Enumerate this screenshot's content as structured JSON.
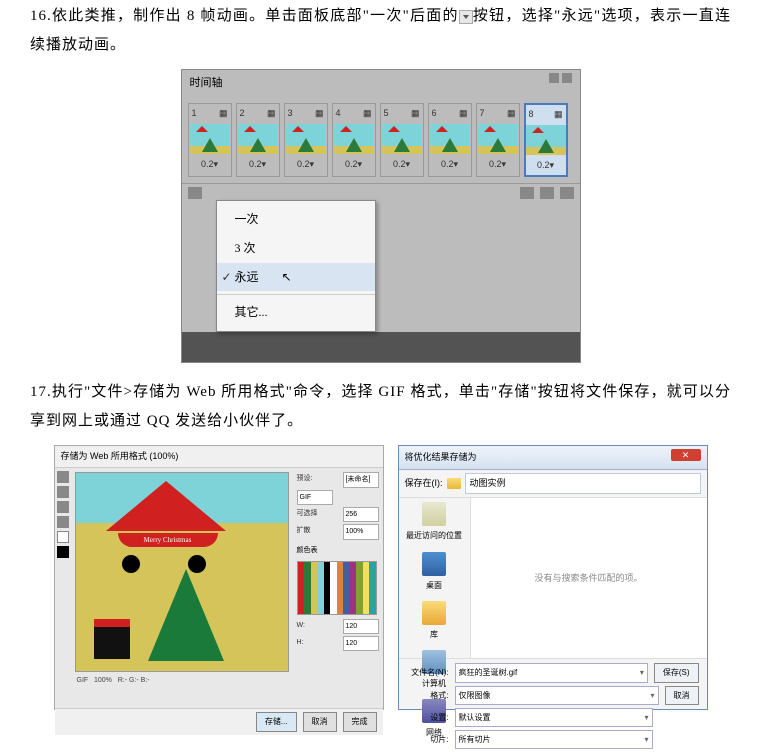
{
  "step16": {
    "text_part1": "16.依此类推，制作出 8 帧动画。单击面板底部\"一次\"后面的",
    "text_part2": "按钮，选择\"永远\"选项，表示一直连续播放动画。"
  },
  "timeline": {
    "title": "时间轴",
    "frames": [
      {
        "num": "1",
        "delay": "0.2▾"
      },
      {
        "num": "2",
        "delay": "0.2▾"
      },
      {
        "num": "3",
        "delay": "0.2▾"
      },
      {
        "num": "4",
        "delay": "0.2▾"
      },
      {
        "num": "5",
        "delay": "0.2▾"
      },
      {
        "num": "6",
        "delay": "0.2▾"
      },
      {
        "num": "7",
        "delay": "0.2▾"
      },
      {
        "num": "8",
        "delay": "0.2▾"
      }
    ],
    "loop_menu": {
      "once": "一次",
      "three": "3 次",
      "forever": "永远",
      "other": "其它..."
    }
  },
  "step17": {
    "text": "17.执行\"文件>存储为 Web 所用格式\"命令，选择 GIF 格式，单击\"存储\"按钮将文件保存，就可以分享到网上或通过 QQ 发送给小伙伴了。"
  },
  "sfw": {
    "title": "存储为 Web 所用格式 (100%)",
    "banner": "Merry Christmas",
    "preset_label": "预设:",
    "preset_value": "[未命名]",
    "format": "GIF",
    "table_label": "颜色表",
    "save_btn": "存储...",
    "cancel_btn": "取消",
    "done_btn": "完成"
  },
  "save_dialog": {
    "title": "将优化结果存储为",
    "path_label": "保存在(I):",
    "path": "动图实例",
    "empty_msg": "没有与搜索条件匹配的项。",
    "sidebar": {
      "recent": "最近访问的位置",
      "desktop": "桌面",
      "library": "库",
      "computer": "计算机",
      "network": "网络"
    },
    "filename_label": "文件名(N):",
    "filename": "疯狂的圣诞树.gif",
    "format_label": "格式:",
    "format": "仅限图像",
    "settings_label": "设置:",
    "settings": "默认设置",
    "slices_label": "切片:",
    "slices": "所有切片",
    "save_btn": "保存(S)",
    "cancel_btn": "取消"
  }
}
